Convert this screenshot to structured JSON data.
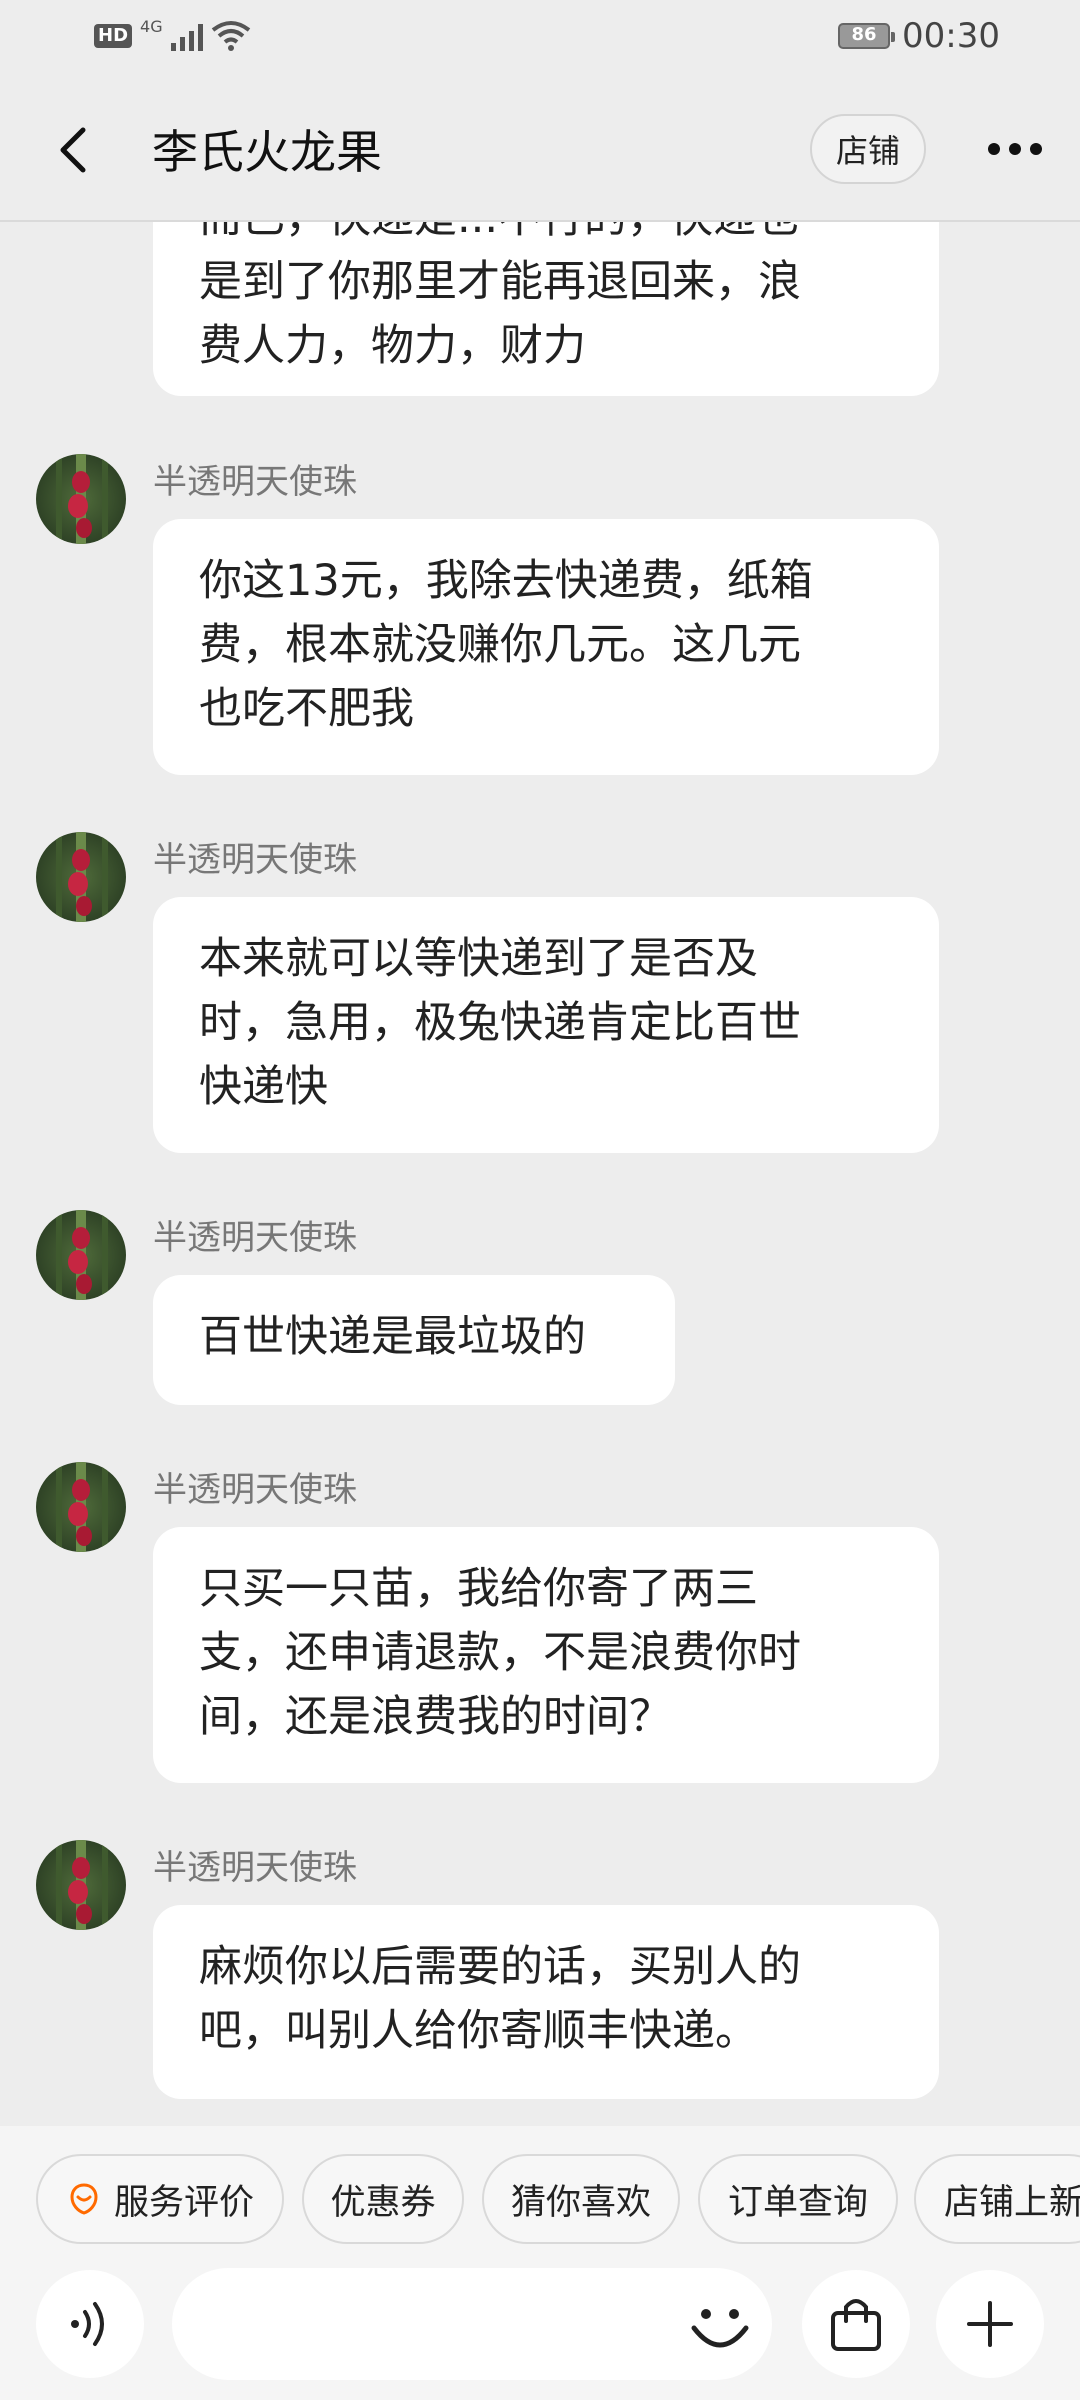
{
  "status_bar": {
    "hd": "HD",
    "network": "4G",
    "battery": "86",
    "time": "00:30"
  },
  "header": {
    "title": "李氏火龙果",
    "shop_button": "店铺"
  },
  "messages": [
    {
      "sender": "",
      "lines": [
        "而已，快递是...不行的，快递也",
        "是到了你那里才能再退回来，浪",
        "费人力，物力，财力"
      ]
    },
    {
      "sender": "半透明天使珠",
      "lines": [
        "你这13元，我除去快递费，纸箱",
        "费，根本就没赚你几元。这几元",
        "也吃不肥我"
      ]
    },
    {
      "sender": "半透明天使珠",
      "lines": [
        "本来就可以等快递到了是否及",
        "时，急用，极兔快递肯定比百世",
        "快递快"
      ]
    },
    {
      "sender": "半透明天使珠",
      "lines": [
        "百世快递是最垃圾的"
      ]
    },
    {
      "sender": "半透明天使珠",
      "lines": [
        "只买一只苗，我给你寄了两三",
        "支，还申请退款，不是浪费你时",
        "间，还是浪费我的时间？"
      ]
    },
    {
      "sender": "半透明天使珠",
      "lines": [
        "麻烦你以后需要的话，买别人的",
        "吧，叫别人给你寄顺丰快递。"
      ]
    }
  ],
  "quick_actions": [
    "服务评价",
    "优惠券",
    "猜你喜欢",
    "订单查询",
    "店铺上新"
  ],
  "input": {
    "placeholder": ""
  },
  "icons": {
    "back": "chevron-left-icon",
    "more": "more-dots-icon",
    "voice": "voice-icon",
    "emoji": "smiley-icon",
    "bag": "shopping-bag-icon",
    "add": "plus-icon",
    "service": "service-rating-icon"
  },
  "colors": {
    "background": "#ededed",
    "bubble": "#ffffff",
    "accent": "#ff6a00"
  }
}
